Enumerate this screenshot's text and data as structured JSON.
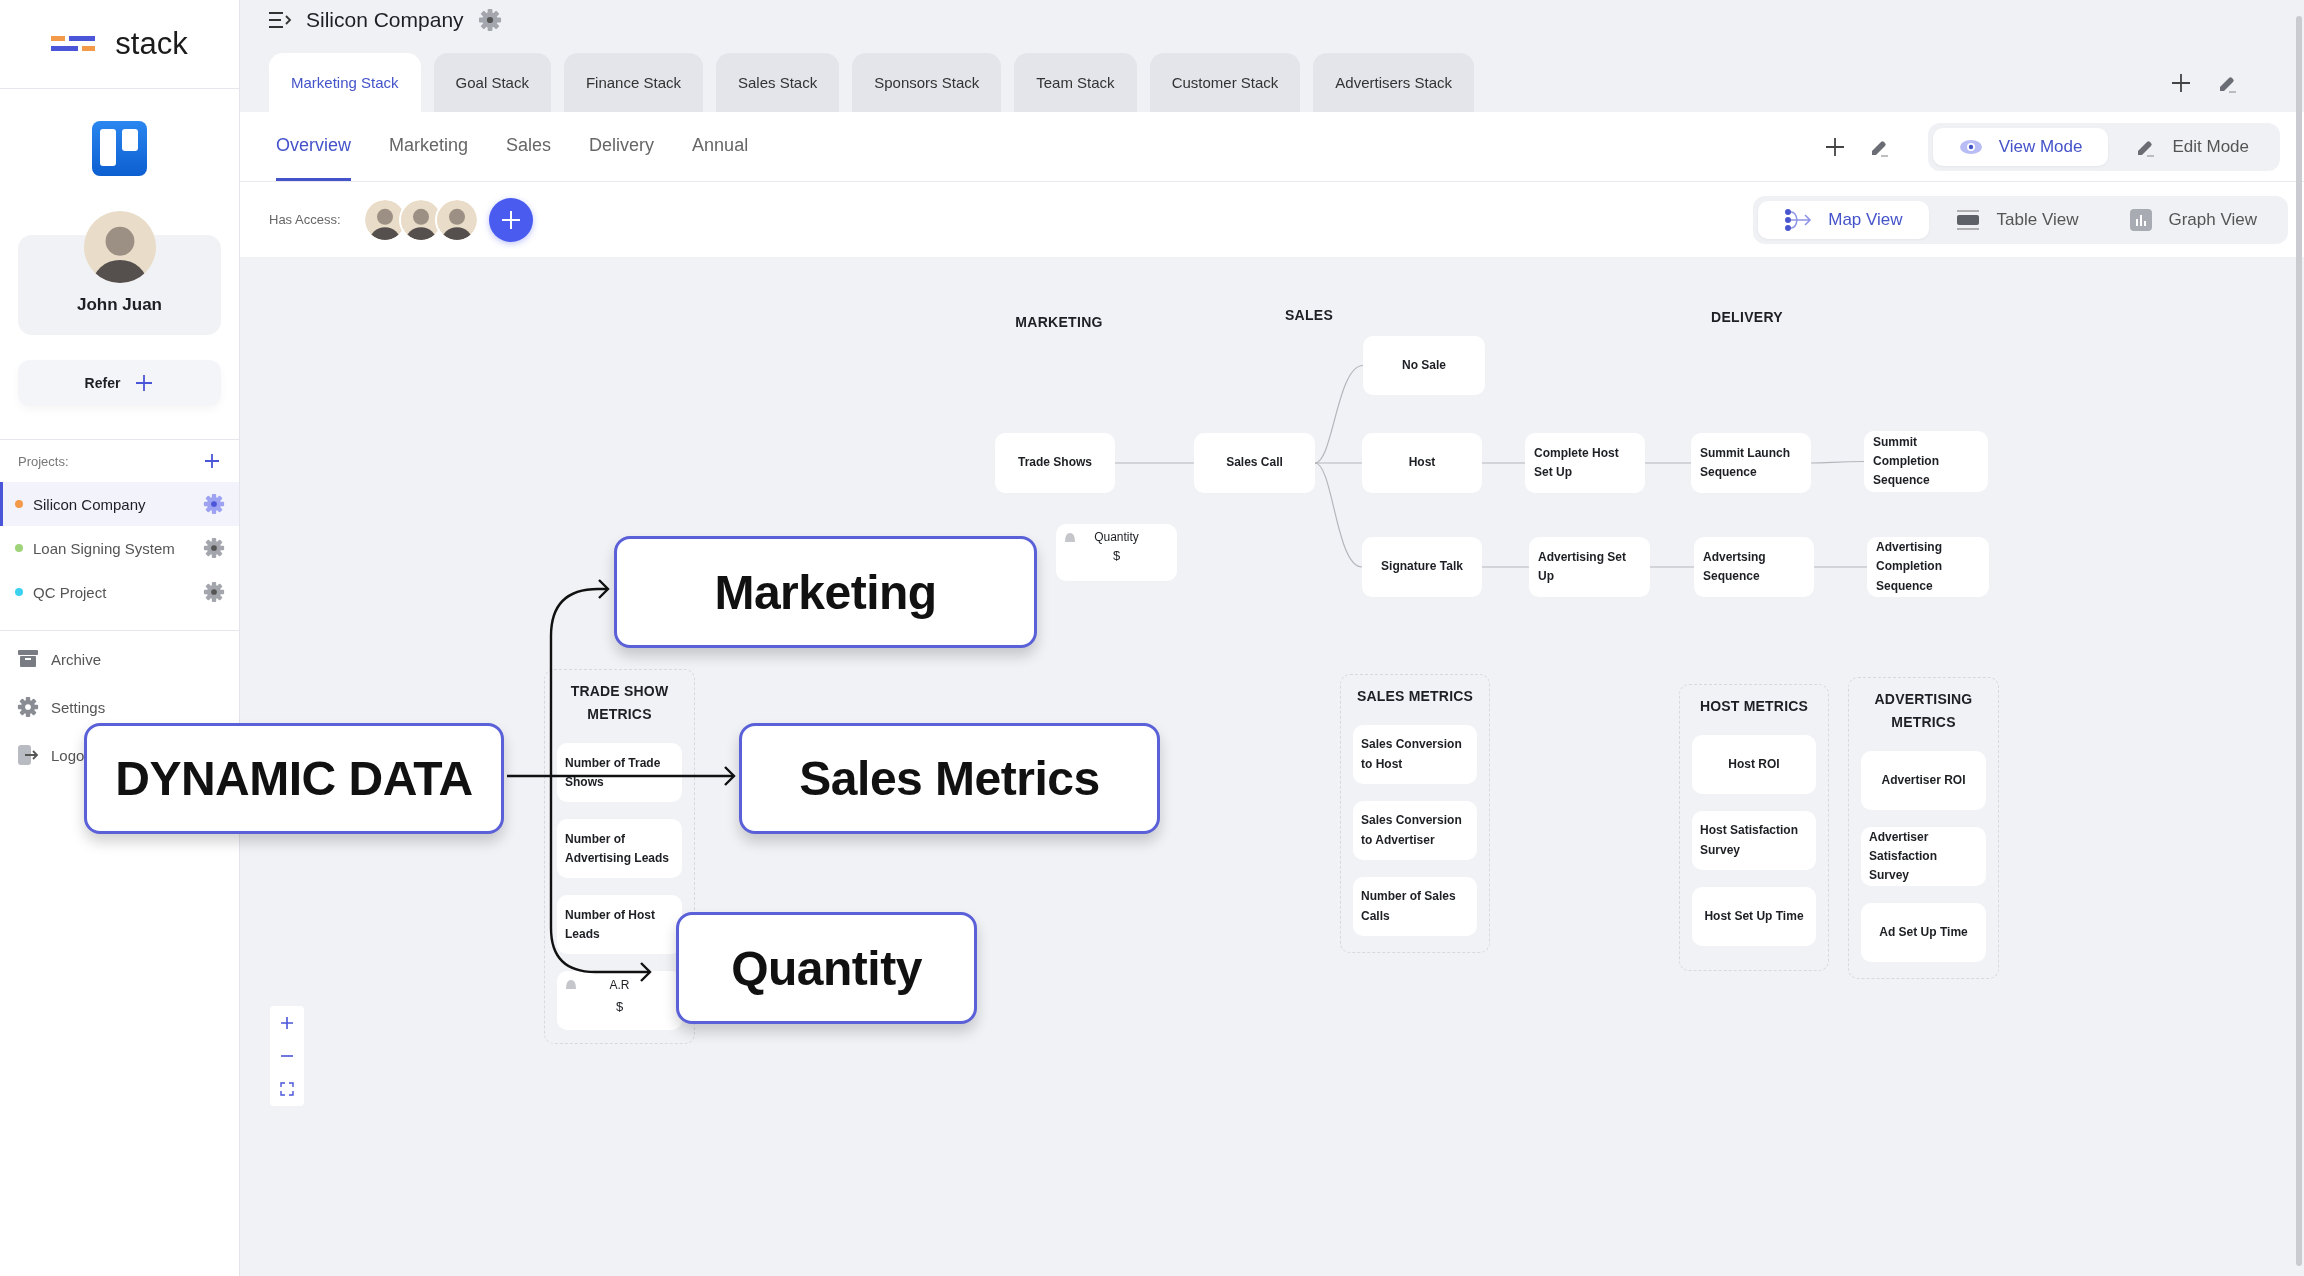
{
  "sidebar": {
    "logo": "stack",
    "user": {
      "name": "John Juan"
    },
    "refer_button": {
      "label": "Refer"
    },
    "projects_label": "Projects:",
    "projects": [
      {
        "name": "Silicon Company",
        "color": "#f2994a",
        "selected": true
      },
      {
        "name": "Loan Signing System",
        "color": "#9fd37a",
        "selected": false
      },
      {
        "name": "QC Project",
        "color": "#3dd0f0",
        "selected": false
      }
    ],
    "menu": [
      {
        "label": "Archive",
        "kind": "archive"
      },
      {
        "label": "Settings",
        "kind": "settings"
      },
      {
        "label": "Logo",
        "kind": "logout"
      }
    ]
  },
  "header": {
    "title": "Silicon Company"
  },
  "stack_tabs": [
    {
      "label": "Marketing Stack",
      "selected": true
    },
    {
      "label": "Goal Stack",
      "selected": false
    },
    {
      "label": "Finance Stack",
      "selected": false
    },
    {
      "label": "Sales Stack",
      "selected": false
    },
    {
      "label": "Sponsors Stack",
      "selected": false
    },
    {
      "label": "Team Stack",
      "selected": false
    },
    {
      "label": "Customer Stack",
      "selected": false
    },
    {
      "label": "Advertisers Stack",
      "selected": false
    }
  ],
  "view_tabs": [
    {
      "label": "Overview",
      "selected": true
    },
    {
      "label": "Marketing",
      "selected": false
    },
    {
      "label": "Sales",
      "selected": false
    },
    {
      "label": "Delivery",
      "selected": false
    },
    {
      "label": "Annual",
      "selected": false
    }
  ],
  "mode_toggle": [
    {
      "label": "View Mode",
      "kind": "view",
      "selected": true
    },
    {
      "label": "Edit Mode",
      "kind": "edit",
      "selected": false
    }
  ],
  "access": {
    "label": "Has Access:"
  },
  "view_switch": [
    {
      "label": "Map View",
      "kind": "map",
      "selected": true
    },
    {
      "label": "Table View",
      "kind": "table",
      "selected": false
    },
    {
      "label": "Graph View",
      "kind": "graph",
      "selected": false
    }
  ],
  "canvas": {
    "sections": [
      {
        "label": "MARKETING"
      },
      {
        "label": "SALES"
      },
      {
        "label": "DELIVERY"
      }
    ],
    "nodes": [
      {
        "label": "Trade Shows"
      },
      {
        "label": "Sales Call"
      },
      {
        "label": "No Sale"
      },
      {
        "label": "Host"
      },
      {
        "label": "Complete Host Set Up"
      },
      {
        "label": "Summit Launch Sequence"
      },
      {
        "label": "Summit Completion Sequence"
      },
      {
        "label": "Signature Talk"
      },
      {
        "label": "Advertising Set Up"
      },
      {
        "label": "Advertsing Sequence"
      },
      {
        "label": "Advertising Completion Sequence"
      }
    ],
    "value_cards": [
      {
        "label": "Quantity",
        "value": "$"
      }
    ],
    "groups": [
      {
        "title": "TRADE SHOW METRICS",
        "items": [
          {
            "kind": "metric",
            "label": "Number of Trade Shows"
          },
          {
            "kind": "metric",
            "label": "Number of Advertising Leads"
          },
          {
            "kind": "metric",
            "label": "Number of Host Leads"
          },
          {
            "kind": "value",
            "label": "A.R",
            "value": "$"
          }
        ]
      },
      {
        "title": "SALES METRICS",
        "items": [
          {
            "kind": "metric",
            "label": "Sales Conversion to Host"
          },
          {
            "kind": "metric",
            "label": "Sales Conversion to Advertiser"
          },
          {
            "kind": "metric",
            "label": "Number of Sales Calls"
          }
        ]
      },
      {
        "title": "HOST METRICS",
        "items": [
          {
            "kind": "metric",
            "label": "Host ROI"
          },
          {
            "kind": "metric",
            "label": "Host Satisfaction Survey"
          },
          {
            "kind": "metric",
            "label": "Host Set Up Time"
          }
        ]
      },
      {
        "title": "ADVERTISING METRICS",
        "items": [
          {
            "kind": "metric",
            "label": "Advertiser ROI"
          },
          {
            "kind": "metric",
            "label": "Advertiser Satisfaction Survey"
          },
          {
            "kind": "metric",
            "label": "Ad Set Up Time"
          }
        ]
      }
    ]
  },
  "callouts": [
    {
      "label": "Marketing"
    },
    {
      "label": "Sales Metrics"
    },
    {
      "label": "Quantity"
    },
    {
      "label": "DYNAMIC DATA"
    }
  ]
}
